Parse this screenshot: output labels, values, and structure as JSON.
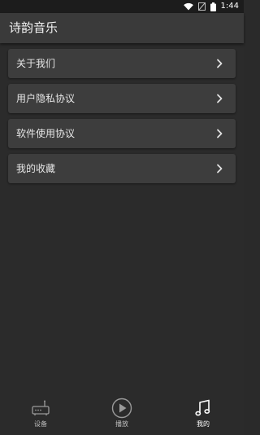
{
  "status_bar": {
    "time": "1:44",
    "icons": [
      "wifi-icon",
      "no-signal-icon",
      "battery-icon"
    ]
  },
  "app_bar": {
    "title": "诗韵音乐"
  },
  "menu": {
    "items": [
      {
        "label": "关于我们",
        "icon": "chevron-right-icon"
      },
      {
        "label": "用户隐私协议",
        "icon": "chevron-right-icon"
      },
      {
        "label": "软件使用协议",
        "icon": "chevron-right-icon"
      },
      {
        "label": "我的收藏",
        "icon": "chevron-right-icon"
      }
    ]
  },
  "bottom_nav": {
    "items": [
      {
        "label": "设备",
        "icon": "router-device-icon",
        "active": false
      },
      {
        "label": "播放",
        "icon": "play-circle-icon",
        "active": false
      },
      {
        "label": "我的",
        "icon": "music-note-icon",
        "active": true
      }
    ]
  },
  "colors": {
    "background": "#2b2b2b",
    "app_bar": "#3a3a3a",
    "card": "#3d3d3d",
    "text": "#e6e6e6",
    "status_bar": "#1c1c1c"
  }
}
